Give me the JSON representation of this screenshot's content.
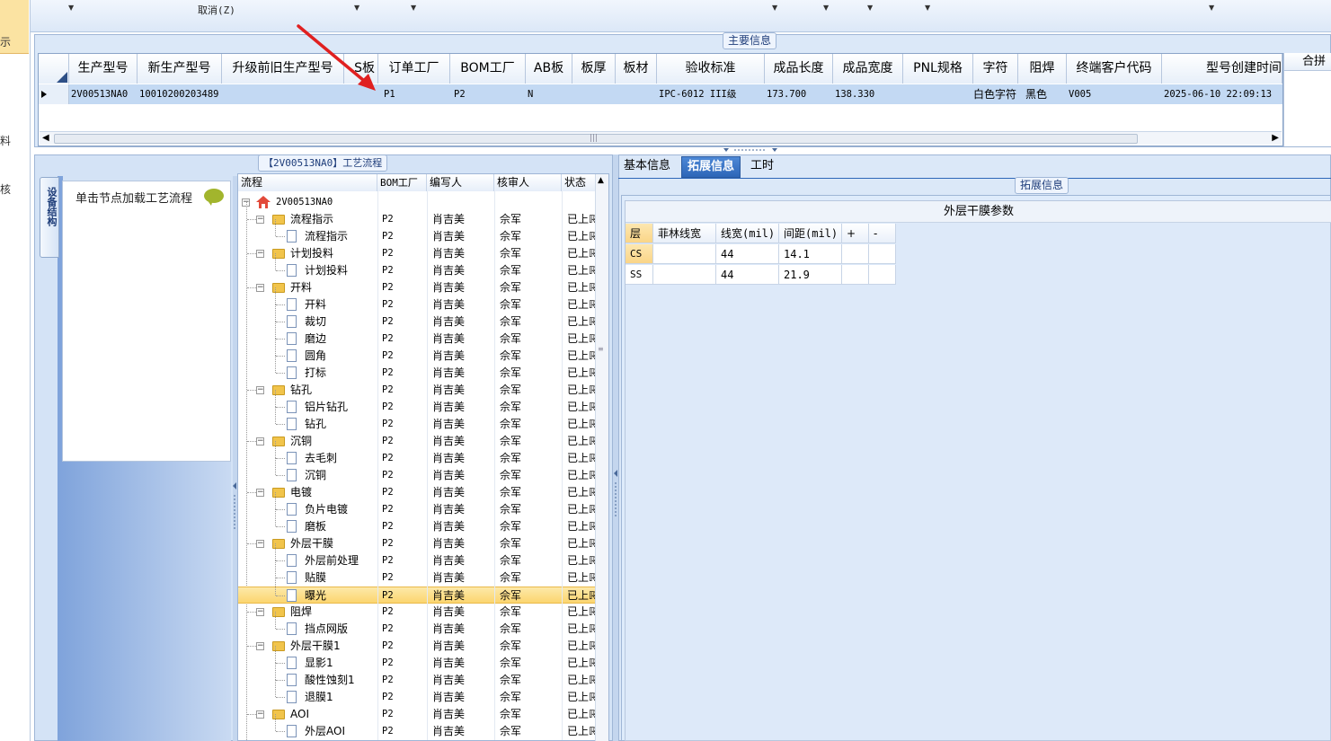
{
  "toolbar": {
    "cancel_label": "取消(Z)"
  },
  "left_strip": {
    "chars": [
      "示",
      "料",
      "核"
    ]
  },
  "main_info": {
    "title": "主要信息",
    "columns": [
      "生产型号",
      "新生产型号",
      "升级前旧生产型号",
      "S板",
      "订单工厂",
      "BOM工厂",
      "AB板",
      "板厚",
      "板材",
      "验收标准",
      "成品长度",
      "成品宽度",
      "PNL规格",
      "字符",
      "阻焊",
      "终端客户代码",
      "型号创建时间"
    ],
    "row": {
      "model": "2V00513NA0",
      "new_model": "10010200203489",
      "old_model": "",
      "s_board": "",
      "order_factory": "P1",
      "bom_factory": "P2",
      "ab_board": "N",
      "thickness": "",
      "material": "",
      "standard": "IPC-6012 III级",
      "length": "173.700",
      "width": "138.330",
      "pnl": "",
      "char": "白色字符",
      "solder": "黑色",
      "customer": "V005",
      "created": "2025-06-10 22:09:13"
    },
    "extra_header": "合拼"
  },
  "process": {
    "title": "【2V00513NA0】工艺流程",
    "side_tab": "设备结构",
    "load_hint": "单击节点加载工艺流程",
    "columns": [
      "流程",
      "BOM工厂",
      "编写人",
      "核审人",
      "状态"
    ],
    "root": "2V00513NA0",
    "rows": [
      {
        "level": 1,
        "name": "流程指示",
        "bom": "P2",
        "writer": "肖吉美",
        "reviewer": "佘军",
        "status": "已上ℝ"
      },
      {
        "level": 2,
        "name": "流程指示",
        "bom": "P2",
        "writer": "肖吉美",
        "reviewer": "佘军",
        "status": "已上ℝ"
      },
      {
        "level": 1,
        "name": "计划投料",
        "bom": "P2",
        "writer": "肖吉美",
        "reviewer": "佘军",
        "status": "已上ℝ"
      },
      {
        "level": 2,
        "name": "计划投料",
        "bom": "P2",
        "writer": "肖吉美",
        "reviewer": "佘军",
        "status": "已上ℝ"
      },
      {
        "level": 1,
        "name": "开料",
        "bom": "P2",
        "writer": "肖吉美",
        "reviewer": "佘军",
        "status": "已上ℝ"
      },
      {
        "level": 2,
        "name": "开料",
        "bom": "P2",
        "writer": "肖吉美",
        "reviewer": "佘军",
        "status": "已上ℝ"
      },
      {
        "level": 2,
        "name": "裁切",
        "bom": "P2",
        "writer": "肖吉美",
        "reviewer": "佘军",
        "status": "已上ℝ"
      },
      {
        "level": 2,
        "name": "磨边",
        "bom": "P2",
        "writer": "肖吉美",
        "reviewer": "佘军",
        "status": "已上ℝ"
      },
      {
        "level": 2,
        "name": "圆角",
        "bom": "P2",
        "writer": "肖吉美",
        "reviewer": "佘军",
        "status": "已上ℝ"
      },
      {
        "level": 2,
        "name": "打标",
        "bom": "P2",
        "writer": "肖吉美",
        "reviewer": "佘军",
        "status": "已上ℝ"
      },
      {
        "level": 1,
        "name": "钻孔",
        "bom": "P2",
        "writer": "肖吉美",
        "reviewer": "佘军",
        "status": "已上ℝ"
      },
      {
        "level": 2,
        "name": "铝片钻孔",
        "bom": "P2",
        "writer": "肖吉美",
        "reviewer": "佘军",
        "status": "已上ℝ"
      },
      {
        "level": 2,
        "name": "钻孔",
        "bom": "P2",
        "writer": "肖吉美",
        "reviewer": "佘军",
        "status": "已上ℝ"
      },
      {
        "level": 1,
        "name": "沉铜",
        "bom": "P2",
        "writer": "肖吉美",
        "reviewer": "佘军",
        "status": "已上ℝ"
      },
      {
        "level": 2,
        "name": "去毛刺",
        "bom": "P2",
        "writer": "肖吉美",
        "reviewer": "佘军",
        "status": "已上ℝ"
      },
      {
        "level": 2,
        "name": "沉铜",
        "bom": "P2",
        "writer": "肖吉美",
        "reviewer": "佘军",
        "status": "已上ℝ"
      },
      {
        "level": 1,
        "name": "电镀",
        "bom": "P2",
        "writer": "肖吉美",
        "reviewer": "佘军",
        "status": "已上ℝ"
      },
      {
        "level": 2,
        "name": "负片电镀",
        "bom": "P2",
        "writer": "肖吉美",
        "reviewer": "佘军",
        "status": "已上ℝ"
      },
      {
        "level": 2,
        "name": "磨板",
        "bom": "P2",
        "writer": "肖吉美",
        "reviewer": "佘军",
        "status": "已上ℝ"
      },
      {
        "level": 1,
        "name": "外层干膜",
        "bom": "P2",
        "writer": "肖吉美",
        "reviewer": "佘军",
        "status": "已上ℝ"
      },
      {
        "level": 2,
        "name": "外层前处理",
        "bom": "P2",
        "writer": "肖吉美",
        "reviewer": "佘军",
        "status": "已上ℝ"
      },
      {
        "level": 2,
        "name": "贴膜",
        "bom": "P2",
        "writer": "肖吉美",
        "reviewer": "佘军",
        "status": "已上ℝ"
      },
      {
        "level": 2,
        "name": "曝光",
        "bom": "P2",
        "writer": "肖吉美",
        "reviewer": "佘军",
        "status": "已上ℝ",
        "selected": true
      },
      {
        "level": 1,
        "name": "阻焊",
        "bom": "P2",
        "writer": "肖吉美",
        "reviewer": "佘军",
        "status": "已上ℝ"
      },
      {
        "level": 2,
        "name": "挡点网版",
        "bom": "P2",
        "writer": "肖吉美",
        "reviewer": "佘军",
        "status": "已上ℝ"
      },
      {
        "level": 1,
        "name": "外层干膜1",
        "bom": "P2",
        "writer": "肖吉美",
        "reviewer": "佘军",
        "status": "已上ℝ"
      },
      {
        "level": 2,
        "name": "显影1",
        "bom": "P2",
        "writer": "肖吉美",
        "reviewer": "佘军",
        "status": "已上ℝ"
      },
      {
        "level": 2,
        "name": "酸性蚀刻1",
        "bom": "P2",
        "writer": "肖吉美",
        "reviewer": "佘军",
        "status": "已上ℝ"
      },
      {
        "level": 2,
        "name": "退膜1",
        "bom": "P2",
        "writer": "肖吉美",
        "reviewer": "佘军",
        "status": "已上ℝ"
      },
      {
        "level": 1,
        "name": "AOI",
        "bom": "P2",
        "writer": "肖吉美",
        "reviewer": "佘军",
        "status": "已上ℝ"
      },
      {
        "level": 2,
        "name": "外层AOI",
        "bom": "P2",
        "writer": "肖吉美",
        "reviewer": "佘军",
        "status": "已上ℝ"
      }
    ]
  },
  "right": {
    "tabs": [
      "基本信息",
      "拓展信息",
      "工时"
    ],
    "active_tab": "拓展信息",
    "ext_title": "拓展信息",
    "param_title": "外层干膜参数",
    "param_columns": [
      "层",
      "菲林线宽",
      "线宽(mil)",
      "间距(mil)",
      "+",
      "-"
    ],
    "param_rows": [
      {
        "layer": "CS",
        "film": "",
        "width": "44",
        "spacing": "14.1"
      },
      {
        "layer": "SS",
        "film": "",
        "width": "44",
        "spacing": "21.9"
      }
    ]
  },
  "colors": {
    "accent": "#2d66b8",
    "selected_row": "#c3d9f3",
    "selected_node": "#fbd56f",
    "arrow": "#e02020"
  }
}
